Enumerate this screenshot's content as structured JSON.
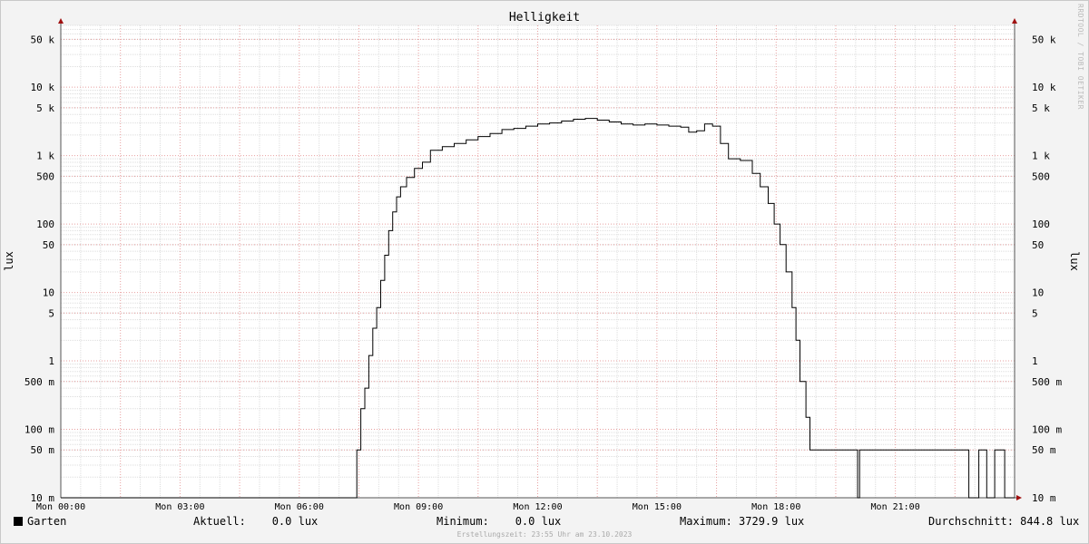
{
  "chart_data": {
    "type": "line",
    "title": "Helligkeit",
    "ylabel": "lux",
    "yscale": "log",
    "ylim": [
      0.01,
      80000
    ],
    "xlim": [
      0,
      24
    ],
    "grid": true,
    "x_ticks": [
      {
        "x": 0,
        "label": "Mon 00:00"
      },
      {
        "x": 3,
        "label": "Mon 03:00"
      },
      {
        "x": 6,
        "label": "Mon 06:00"
      },
      {
        "x": 9,
        "label": "Mon 09:00"
      },
      {
        "x": 12,
        "label": "Mon 12:00"
      },
      {
        "x": 15,
        "label": "Mon 15:00"
      },
      {
        "x": 18,
        "label": "Mon 18:00"
      },
      {
        "x": 21,
        "label": "Mon 21:00"
      }
    ],
    "y_ticks": [
      {
        "y": 50000,
        "label": "50 k"
      },
      {
        "y": 10000,
        "label": "10 k"
      },
      {
        "y": 5000,
        "label": "5 k"
      },
      {
        "y": 1000,
        "label": "1 k"
      },
      {
        "y": 500,
        "label": "500"
      },
      {
        "y": 100,
        "label": "100"
      },
      {
        "y": 50,
        "label": "50"
      },
      {
        "y": 10,
        "label": "10"
      },
      {
        "y": 5,
        "label": "5"
      },
      {
        "y": 1,
        "label": "1"
      },
      {
        "y": 0.5,
        "label": "500 m"
      },
      {
        "y": 0.1,
        "label": "100 m"
      },
      {
        "y": 0.05,
        "label": "50 m"
      },
      {
        "y": 0.01,
        "label": "10 m"
      }
    ],
    "series": [
      {
        "name": "Garten",
        "color": "#000000",
        "points": [
          [
            0,
            0.01
          ],
          [
            7.4,
            0.01
          ],
          [
            7.45,
            0.05
          ],
          [
            7.55,
            0.2
          ],
          [
            7.65,
            0.4
          ],
          [
            7.75,
            1.2
          ],
          [
            7.85,
            3
          ],
          [
            7.95,
            6
          ],
          [
            8.05,
            15
          ],
          [
            8.15,
            35
          ],
          [
            8.25,
            80
          ],
          [
            8.35,
            150
          ],
          [
            8.45,
            250
          ],
          [
            8.55,
            350
          ],
          [
            8.7,
            480
          ],
          [
            8.9,
            650
          ],
          [
            9.1,
            800
          ],
          [
            9.3,
            1200
          ],
          [
            9.6,
            1350
          ],
          [
            9.9,
            1500
          ],
          [
            10.2,
            1700
          ],
          [
            10.5,
            1900
          ],
          [
            10.8,
            2100
          ],
          [
            11.1,
            2400
          ],
          [
            11.4,
            2500
          ],
          [
            11.7,
            2700
          ],
          [
            12.0,
            2900
          ],
          [
            12.3,
            3000
          ],
          [
            12.6,
            3200
          ],
          [
            12.9,
            3400
          ],
          [
            13.2,
            3500
          ],
          [
            13.5,
            3300
          ],
          [
            13.8,
            3100
          ],
          [
            14.1,
            2900
          ],
          [
            14.4,
            2800
          ],
          [
            14.7,
            2900
          ],
          [
            15.0,
            2800
          ],
          [
            15.3,
            2700
          ],
          [
            15.6,
            2600
          ],
          [
            15.8,
            2200
          ],
          [
            16.0,
            2300
          ],
          [
            16.2,
            2900
          ],
          [
            16.4,
            2700
          ],
          [
            16.6,
            1500
          ],
          [
            16.8,
            900
          ],
          [
            17.1,
            850
          ],
          [
            17.4,
            550
          ],
          [
            17.6,
            350
          ],
          [
            17.8,
            200
          ],
          [
            17.95,
            100
          ],
          [
            18.1,
            50
          ],
          [
            18.25,
            20
          ],
          [
            18.4,
            6
          ],
          [
            18.5,
            2
          ],
          [
            18.6,
            0.5
          ],
          [
            18.75,
            0.15
          ],
          [
            18.85,
            0.05
          ],
          [
            20.0,
            0.05
          ],
          [
            20.05,
            0.01
          ],
          [
            20.1,
            0.05
          ],
          [
            22.8,
            0.05
          ],
          [
            22.85,
            0.01
          ],
          [
            23.05,
            0.01
          ],
          [
            23.1,
            0.05
          ],
          [
            23.25,
            0.05
          ],
          [
            23.3,
            0.01
          ],
          [
            23.45,
            0.01
          ],
          [
            23.5,
            0.05
          ],
          [
            23.7,
            0.05
          ],
          [
            23.75,
            0.01
          ],
          [
            24.0,
            0.01
          ]
        ]
      }
    ]
  },
  "legend": {
    "series_name": "Garten",
    "current": "Aktuell:    0.0 lux",
    "minimum": "Minimum:    0.0 lux",
    "maximum": "Maximum: 3729.9 lux",
    "average": "Durchschnitt: 844.8 lux"
  },
  "footer": "Erstellungszeit: 23:55 Uhr am 23.10.2023",
  "watermark": "RRDTOOL / TOBI OETIKER"
}
